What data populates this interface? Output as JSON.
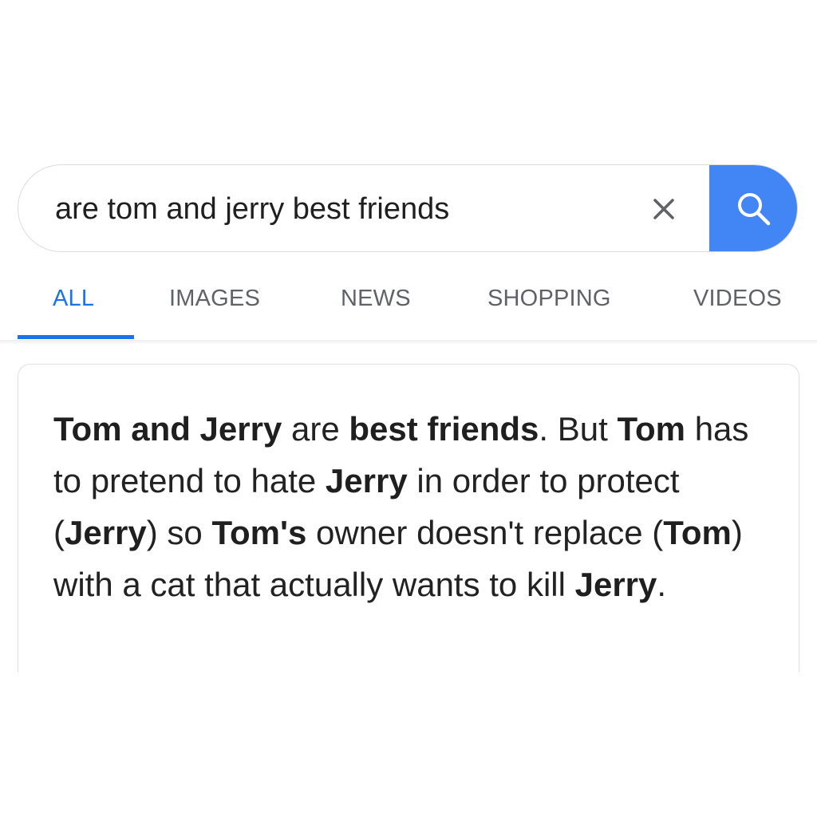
{
  "search": {
    "query": "are tom and jerry best friends",
    "clear_icon": "close-icon",
    "search_icon": "search-icon",
    "accent": "#4285f4"
  },
  "tabs": [
    {
      "label": "ALL",
      "active": true
    },
    {
      "label": "IMAGES",
      "active": false
    },
    {
      "label": "NEWS",
      "active": false
    },
    {
      "label": "SHOPPING",
      "active": false
    },
    {
      "label": "VIDEOS",
      "active": false
    }
  ],
  "tab_colors": {
    "active": "#1a73e8",
    "inactive": "#5f6368"
  },
  "answer": {
    "segments": [
      {
        "text": "Tom and Jerry",
        "bold": true
      },
      {
        "text": " are ",
        "bold": false
      },
      {
        "text": "best friends",
        "bold": true
      },
      {
        "text": ". But ",
        "bold": false
      },
      {
        "text": "Tom",
        "bold": true
      },
      {
        "text": " has to pretend to hate ",
        "bold": false
      },
      {
        "text": "Jerry",
        "bold": true
      },
      {
        "text": " in order to protect (",
        "bold": false
      },
      {
        "text": "Jerry",
        "bold": true
      },
      {
        "text": ") so ",
        "bold": false
      },
      {
        "text": "Tom's",
        "bold": true
      },
      {
        "text": " owner doesn't replace (",
        "bold": false
      },
      {
        "text": "Tom",
        "bold": true
      },
      {
        "text": ") with a cat that actually wants to kill ",
        "bold": false
      },
      {
        "text": "Jerry",
        "bold": true
      },
      {
        "text": ".",
        "bold": false
      }
    ]
  }
}
